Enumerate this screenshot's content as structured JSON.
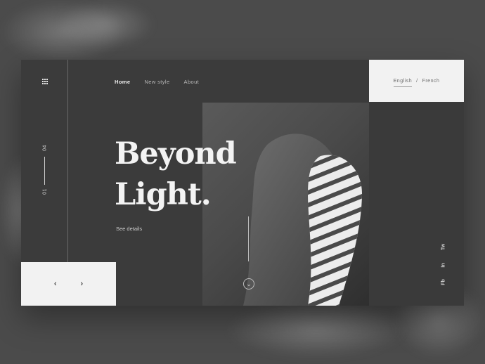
{
  "nav": {
    "items": [
      {
        "label": "Home",
        "active": true
      },
      {
        "label": "New style",
        "active": false
      },
      {
        "label": "About",
        "active": false
      }
    ]
  },
  "lang": {
    "current": "English",
    "separator": "/",
    "other": "French"
  },
  "counter": {
    "top": "04",
    "bottom": "01"
  },
  "hero": {
    "line1": "Beyond",
    "line2": "Light.",
    "cta": "See details"
  },
  "social": {
    "tw": "Tw",
    "in": "In",
    "fb": "Fb"
  },
  "slider": {
    "prev": "‹",
    "next": "›"
  },
  "scroll": {
    "icon": "⌄"
  },
  "icons": {
    "menu": "grid-menu-icon",
    "scroll": "chevron-down-icon",
    "prev": "chevron-left-icon",
    "next": "chevron-right-icon"
  },
  "colors": {
    "background": "#4b4b4b",
    "panel": "#3b3b3b",
    "light_box": "#f2f2f2",
    "text_light": "#f3f3f3"
  }
}
